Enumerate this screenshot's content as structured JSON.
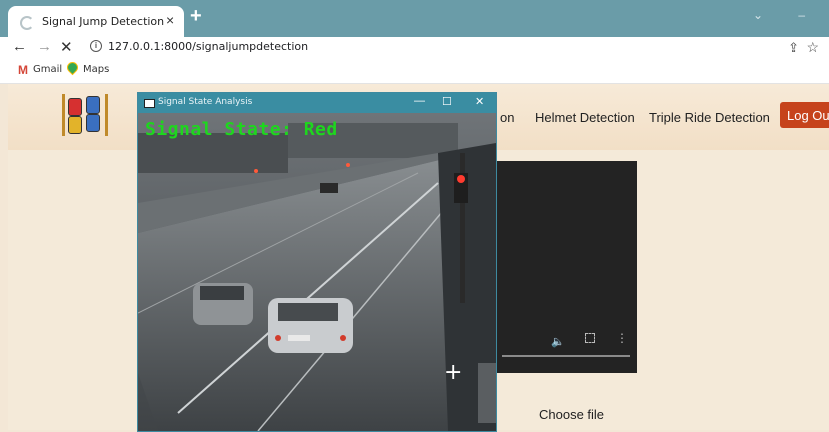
{
  "browser": {
    "tab_title": "Signal Jump Detection",
    "tab_close": "×",
    "new_tab": "+",
    "window_controls": "⌄ –",
    "back": "←",
    "forward": "→",
    "stop": "✕",
    "url": "127.0.0.1:8000/signaljumpdetection",
    "bookmarks": [
      {
        "label": "Gmail",
        "icon": "gmail-icon"
      },
      {
        "label": "Maps",
        "icon": "maps-icon"
      }
    ]
  },
  "navbar": {
    "partial_link": "on",
    "links": [
      "Helmet Detection",
      "Triple Ride Detection"
    ],
    "logout_label": "Log Out"
  },
  "video": {
    "volume_icon": "🔈",
    "fullscreen_icon": "fullscreen-icon",
    "more_icon": "⋮"
  },
  "upload": {
    "choose_file_label": "Choose file"
  },
  "cv_window": {
    "title": "Signal State Analysis",
    "minimize": "—",
    "maximize": "☐",
    "close": "✕",
    "overlay_text": "Signal State: Red",
    "cursor": "+"
  },
  "colors": {
    "tabbar": "#6a9ca8",
    "logout": "#c6431c",
    "overlay_text": "#1ed61e",
    "cv_titlebar": "#3a8da2"
  }
}
